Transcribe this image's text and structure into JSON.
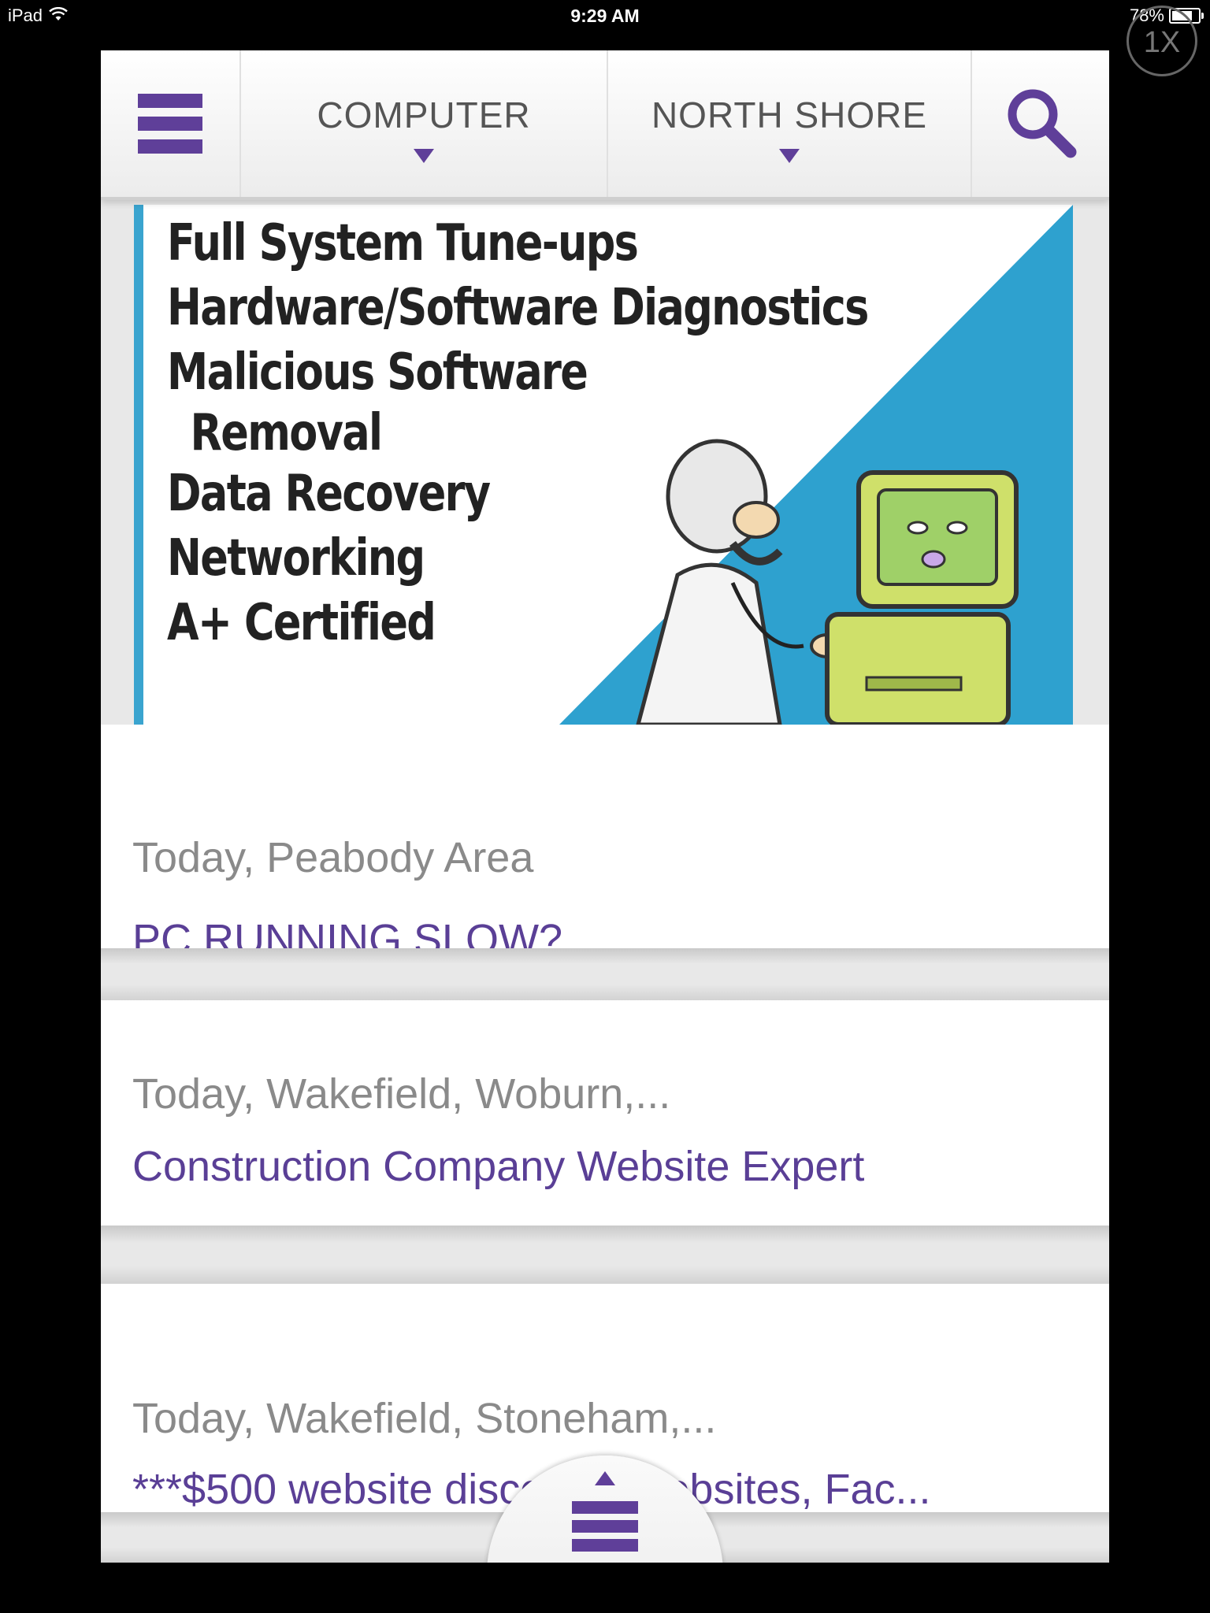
{
  "status_bar": {
    "device": "iPad",
    "time": "9:29 AM",
    "battery_text": "78%",
    "battery_level": 0.78,
    "zoom_badge": "1X"
  },
  "nav": {
    "category_label": "COMPUTER",
    "location_label": "NORTH SHORE",
    "accent_color": "#5f3f99"
  },
  "ad": {
    "lines": [
      "Full System Tune-ups",
      "Hardware/Software Diagnostics",
      "Malicious Software",
      "Removal",
      "Data Recovery",
      "Networking",
      "A+ Certified"
    ]
  },
  "listings": [
    {
      "meta": "Today, Peabody Area",
      "title": "PC RUNNING SLOW?"
    },
    {
      "meta": "Today, Wakefield, Woburn,...",
      "title": "Construction Company Website Expert"
    },
    {
      "meta": "Today, Wakefield, Stoneham,...",
      "title": "***$500 website discount, Websites, Fac..."
    }
  ]
}
